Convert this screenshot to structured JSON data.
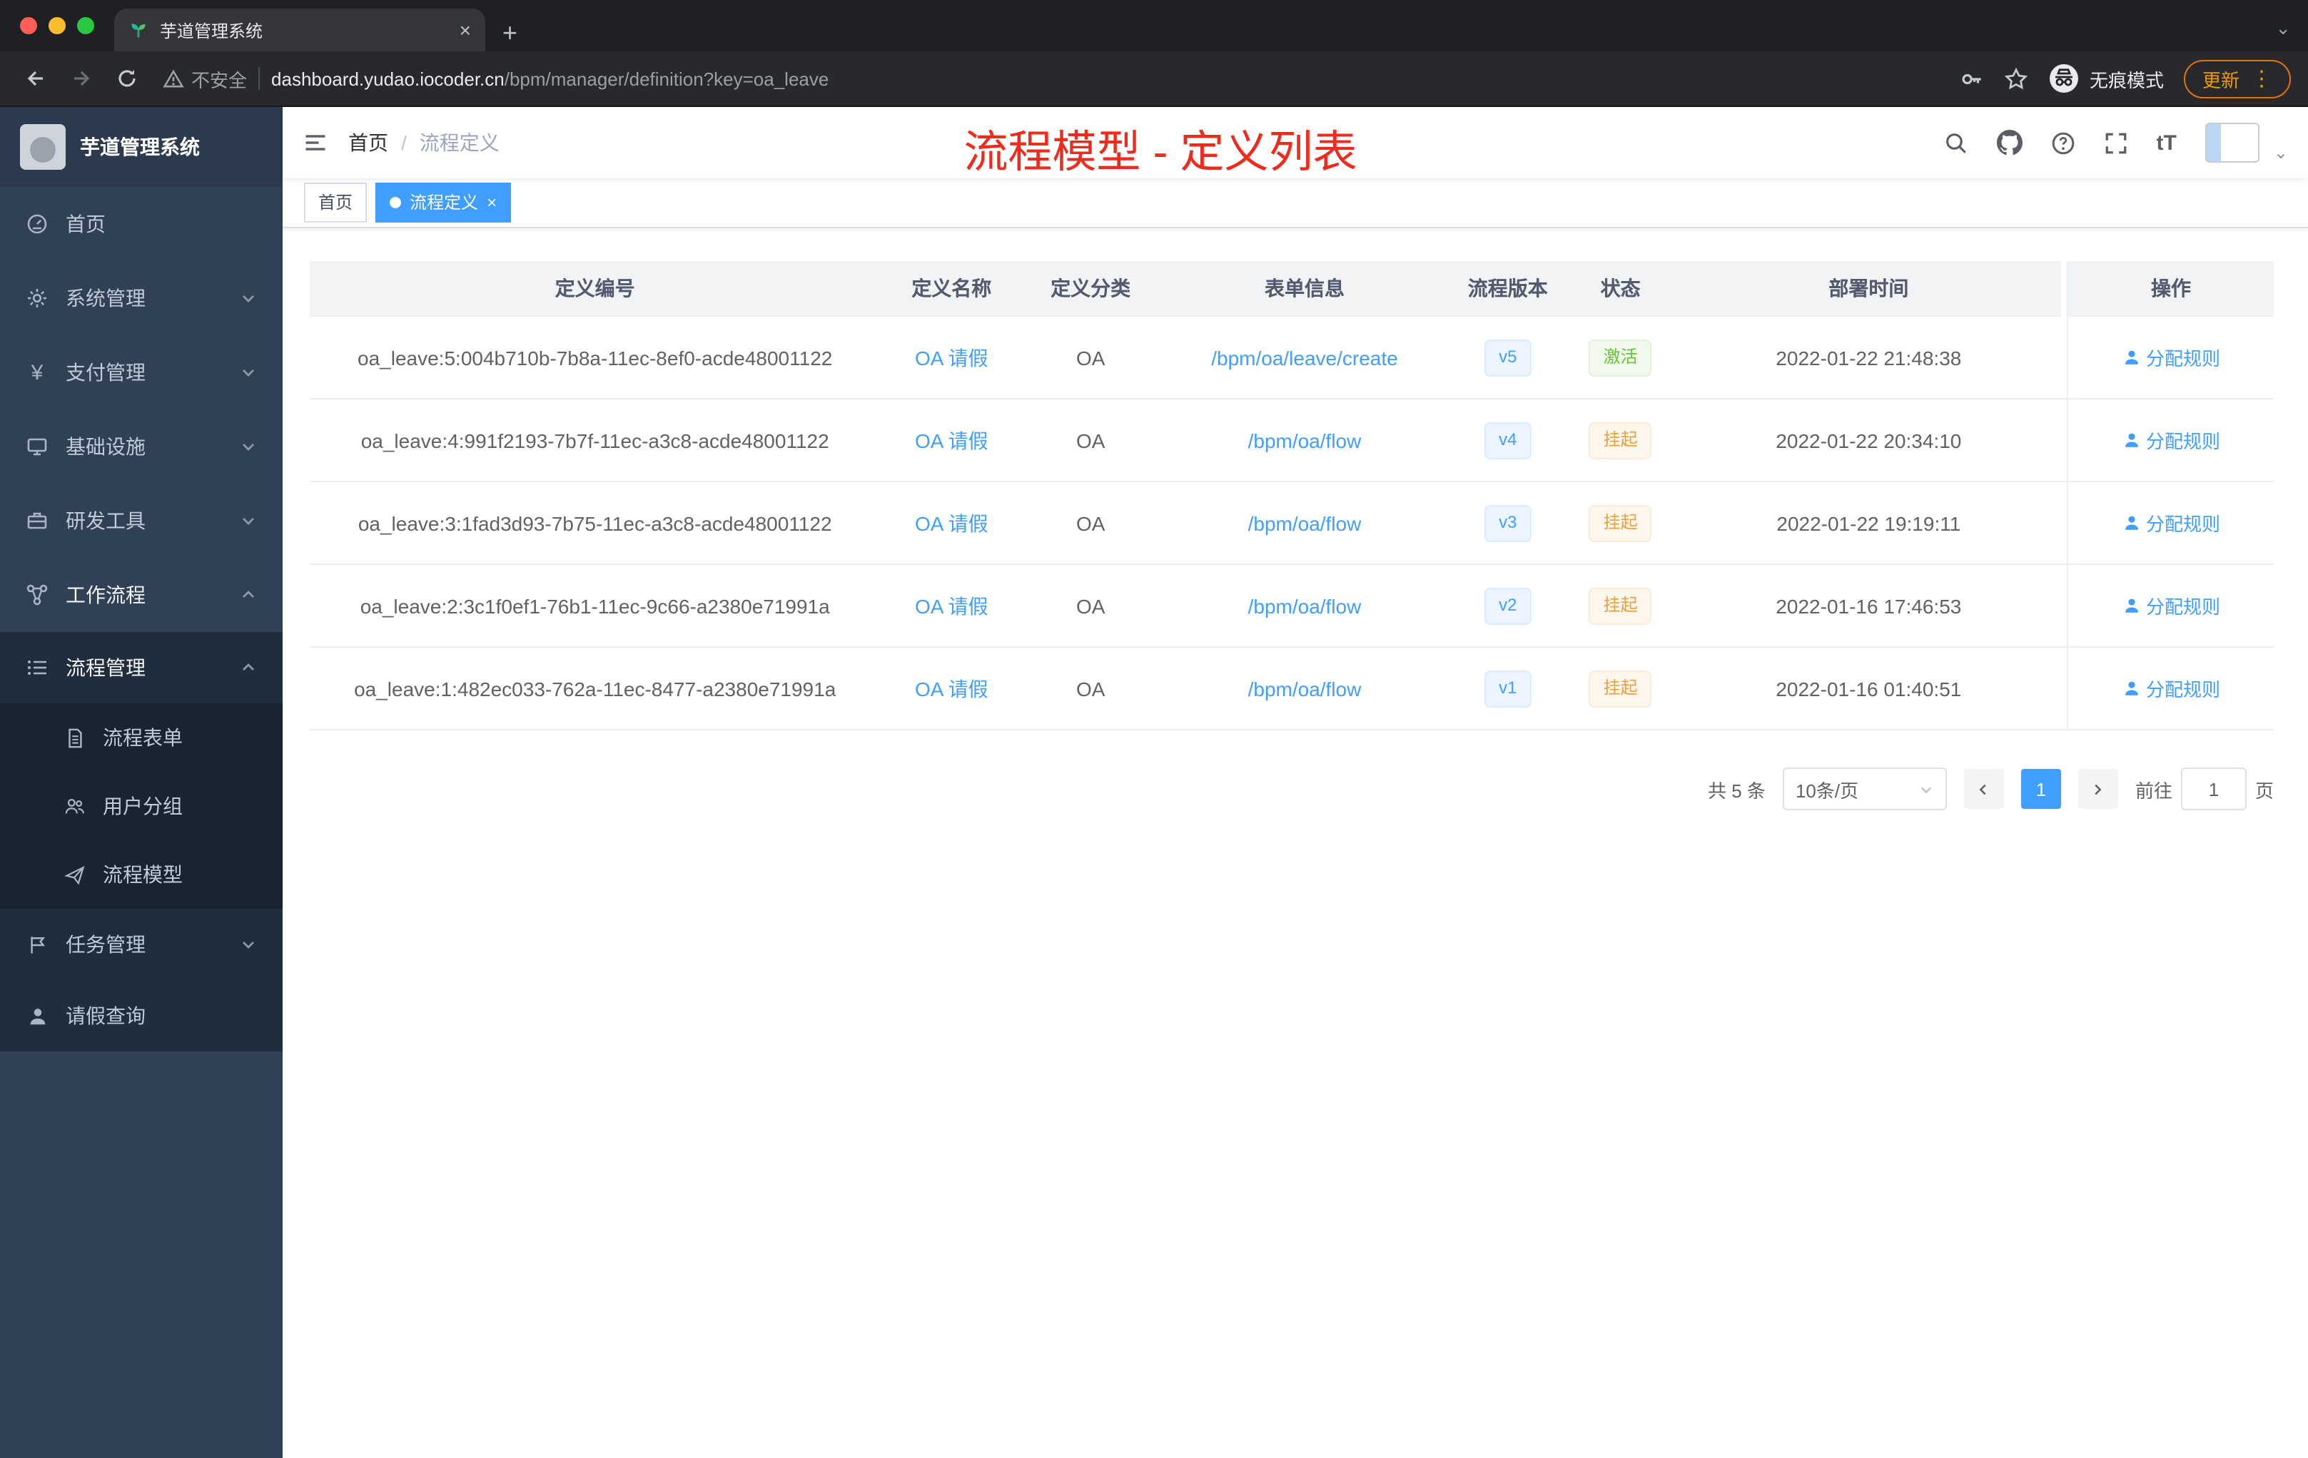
{
  "icons": {
    "close": "×",
    "plus": "+",
    "dots": "⋮",
    "caret_down": "⌄",
    "question": "?",
    "font_size": "tT",
    "yuan": "¥",
    "slash": "/"
  },
  "browser": {
    "tab_title": "芋道管理系统",
    "security_label": "不安全",
    "url_host": "dashboard.yudao.iocoder.cn",
    "url_path": "/bpm/manager/definition?key=oa_leave",
    "incognito_label": "无痕模式",
    "update_label": "更新"
  },
  "sidebar": {
    "logo_title": "芋道管理系统",
    "items": [
      {
        "label": "首页"
      },
      {
        "label": "系统管理"
      },
      {
        "label": "支付管理"
      },
      {
        "label": "基础设施"
      },
      {
        "label": "研发工具"
      },
      {
        "label": "工作流程"
      },
      {
        "label": "流程管理"
      },
      {
        "label": "流程表单"
      },
      {
        "label": "用户分组"
      },
      {
        "label": "流程模型"
      },
      {
        "label": "任务管理"
      },
      {
        "label": "请假查询"
      }
    ]
  },
  "header": {
    "breadcrumb_home": "首页",
    "breadcrumb_current": "流程定义",
    "annotation": "流程模型 - 定义列表"
  },
  "tags": {
    "home": "首页",
    "current": "流程定义"
  },
  "table": {
    "columns": [
      "定义编号",
      "定义名称",
      "定义分类",
      "表单信息",
      "流程版本",
      "状态",
      "部署时间",
      "操作"
    ],
    "action_label": "分配规则",
    "rows": [
      {
        "id": "oa_leave:5:004b710b-7b8a-11ec-8ef0-acde48001122",
        "name": "OA 请假",
        "category": "OA",
        "form": "/bpm/oa/leave/create",
        "version": "v5",
        "status": "激活",
        "time": "2022-01-22 21:48:38"
      },
      {
        "id": "oa_leave:4:991f2193-7b7f-11ec-a3c8-acde48001122",
        "name": "OA 请假",
        "category": "OA",
        "form": "/bpm/oa/flow",
        "version": "v4",
        "status": "挂起",
        "time": "2022-01-22 20:34:10"
      },
      {
        "id": "oa_leave:3:1fad3d93-7b75-11ec-a3c8-acde48001122",
        "name": "OA 请假",
        "category": "OA",
        "form": "/bpm/oa/flow",
        "version": "v3",
        "status": "挂起",
        "time": "2022-01-22 19:19:11"
      },
      {
        "id": "oa_leave:2:3c1f0ef1-76b1-11ec-9c66-a2380e71991a",
        "name": "OA 请假",
        "category": "OA",
        "form": "/bpm/oa/flow",
        "version": "v2",
        "status": "挂起",
        "time": "2022-01-16 17:46:53"
      },
      {
        "id": "oa_leave:1:482ec033-762a-11ec-8477-a2380e71991a",
        "name": "OA 请假",
        "category": "OA",
        "form": "/bpm/oa/flow",
        "version": "v1",
        "status": "挂起",
        "time": "2022-01-16 01:40:51"
      }
    ]
  },
  "pagination": {
    "total": "共 5 条",
    "page_size": "10条/页",
    "page": "1",
    "goto_label": "前往",
    "goto_value": "1",
    "page_unit": "页"
  }
}
